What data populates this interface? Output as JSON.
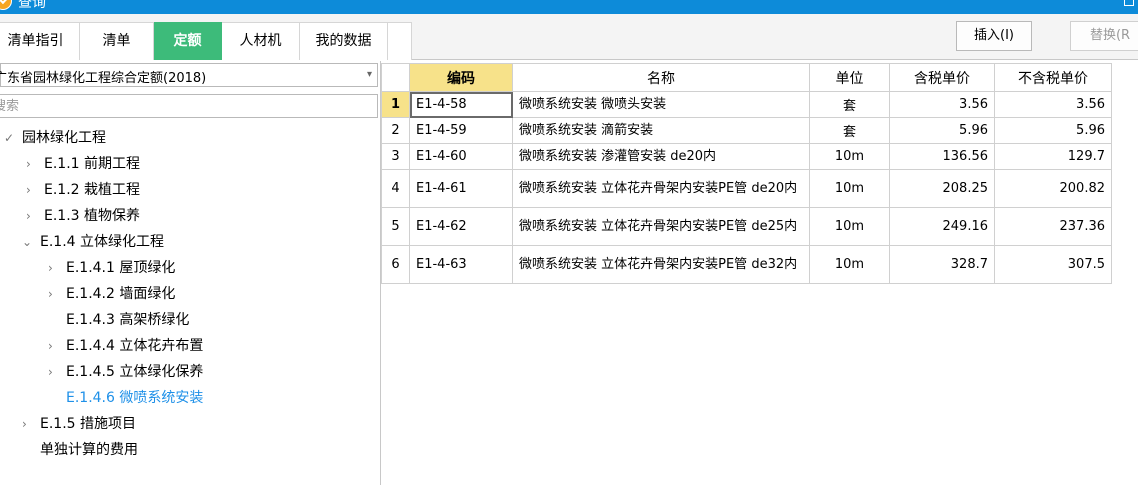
{
  "window": {
    "title": "查询"
  },
  "tabs": [
    {
      "label": "清单指引"
    },
    {
      "label": "清单"
    },
    {
      "label": "定额"
    },
    {
      "label": "人材机"
    },
    {
      "label": "我的数据"
    }
  ],
  "toolbar": {
    "insert_label": "插入(I)",
    "replace_label": "替换(R"
  },
  "library": {
    "selected": "广东省园林绿化工程综合定额(2018)"
  },
  "search": {
    "placeholder": "搜索"
  },
  "tree": [
    {
      "label": "园林绿化工程",
      "toggle": "✓"
    },
    {
      "label": "E.1.1 前期工程",
      "toggle": "›"
    },
    {
      "label": "E.1.2 栽植工程",
      "toggle": "›"
    },
    {
      "label": "E.1.3 植物保养",
      "toggle": "›"
    },
    {
      "label": "E.1.4 立体绿化工程",
      "toggle": "⌄"
    },
    {
      "label": "E.1.4.1 屋顶绿化",
      "toggle": "›"
    },
    {
      "label": "E.1.4.2 墙面绿化",
      "toggle": "›"
    },
    {
      "label": "E.1.4.3 高架桥绿化",
      "toggle": ""
    },
    {
      "label": "E.1.4.4 立体花卉布置",
      "toggle": "›"
    },
    {
      "label": "E.1.4.5 立体绿化保养",
      "toggle": "›"
    },
    {
      "label": "E.1.4.6 微喷系统安装",
      "toggle": ""
    },
    {
      "label": "E.1.5 措施项目",
      "toggle": "›"
    },
    {
      "label": "单独计算的费用",
      "toggle": ""
    }
  ],
  "table": {
    "headers": [
      "编码",
      "名称",
      "单位",
      "含税单价",
      "不含税单价"
    ],
    "rows": [
      {
        "no": "1",
        "code": "E1-4-58",
        "name": "微喷系统安装 微喷头安装",
        "unit": "套",
        "price_tax": "3.56",
        "price_notax": "3.56"
      },
      {
        "no": "2",
        "code": "E1-4-59",
        "name": "微喷系统安装 滴箭安装",
        "unit": "套",
        "price_tax": "5.96",
        "price_notax": "5.96"
      },
      {
        "no": "3",
        "code": "E1-4-60",
        "name": "微喷系统安装 渗灌管安装 de20内",
        "unit": "10m",
        "price_tax": "136.56",
        "price_notax": "129.7"
      },
      {
        "no": "4",
        "code": "E1-4-61",
        "name": "微喷系统安装 立体花卉骨架内安装PE管 de20内",
        "unit": "10m",
        "price_tax": "208.25",
        "price_notax": "200.82"
      },
      {
        "no": "5",
        "code": "E1-4-62",
        "name": "微喷系统安装 立体花卉骨架内安装PE管 de25内",
        "unit": "10m",
        "price_tax": "249.16",
        "price_notax": "237.36"
      },
      {
        "no": "6",
        "code": "E1-4-63",
        "name": "微喷系统安装 立体花卉骨架内安装PE管 de32内",
        "unit": "10m",
        "price_tax": "328.7",
        "price_notax": "307.5"
      }
    ]
  },
  "colors": {
    "titlebar": "#0d8bd9",
    "active_tab": "#3dbb7a",
    "highlight": "#f7e28a",
    "selected_text": "#1e90e8"
  }
}
